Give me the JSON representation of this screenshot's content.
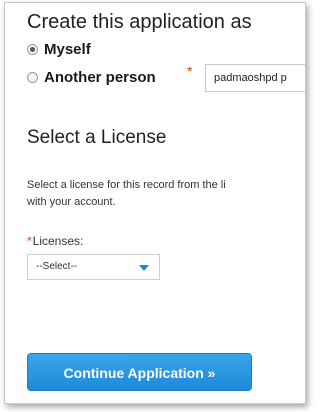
{
  "create_as": {
    "heading": "Create this application as",
    "options": [
      {
        "label": "Myself",
        "selected": true
      },
      {
        "label": "Another person",
        "selected": false
      }
    ],
    "required_marker": "*",
    "another_person_value": "padmaoshpd p"
  },
  "license": {
    "heading": "Select a License",
    "description_line1": "Select a license for this record from the li",
    "description_line2": "with your account.",
    "required_marker": "*",
    "field_label": "Licenses:",
    "selected_value": "--Select--"
  },
  "actions": {
    "continue_label": "Continue Application »"
  },
  "colors": {
    "accent": "#1e8ad8",
    "required": "#d9480f"
  }
}
